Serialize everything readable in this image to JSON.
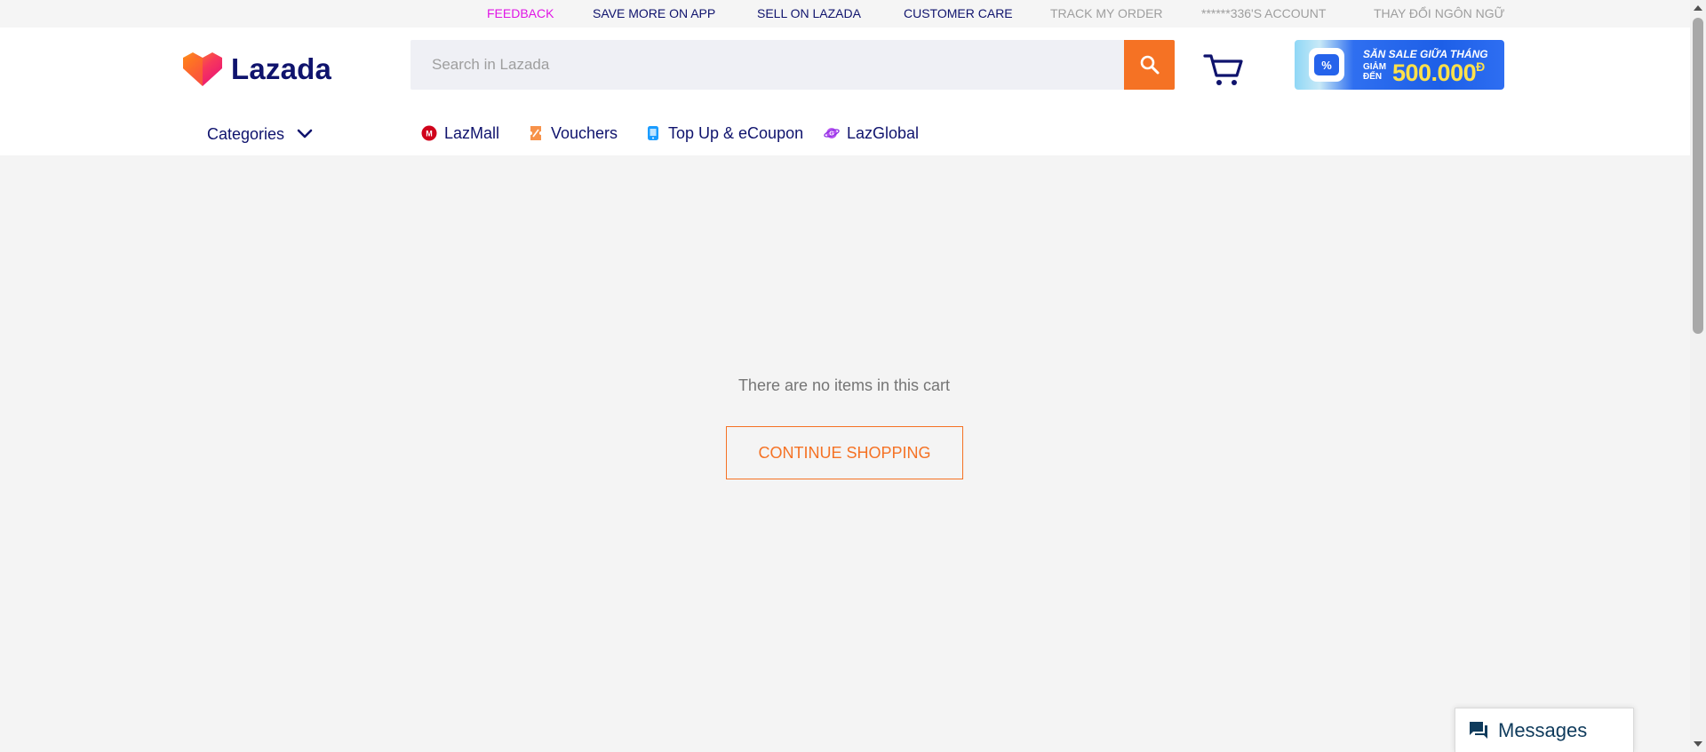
{
  "topbar": {
    "feedback": "FEEDBACK",
    "save_more": "SAVE MORE ON APP",
    "sell": "SELL ON LAZADA",
    "customer_care": "CUSTOMER CARE",
    "track_order": "TRACK MY ORDER",
    "account": "******336'S ACCOUNT",
    "language": "THAY ĐỔI NGÔN NGỮ"
  },
  "header": {
    "logo_text": "Lazada",
    "search_placeholder": "Search in Lazada",
    "search_icon": "search-icon",
    "cart_icon": "cart-icon",
    "banner": {
      "line1": "SĂN SALE GIỮA THÁNG",
      "sub": "GIẢM ĐẾN",
      "amount": "500.000",
      "currency": "Đ"
    }
  },
  "nav": {
    "categories": "Categories",
    "items": [
      {
        "label": "LazMall",
        "icon": "lazmall-icon"
      },
      {
        "label": "Vouchers",
        "icon": "voucher-icon"
      },
      {
        "label": "Top Up & eCoupon",
        "icon": "topup-icon"
      },
      {
        "label": "LazGlobal",
        "icon": "lazglobal-icon"
      }
    ]
  },
  "main": {
    "empty_message": "There are no items in this cart",
    "continue_label": "CONTINUE SHOPPING"
  },
  "messages": {
    "label": "Messages"
  },
  "colors": {
    "accent": "#f57224",
    "navy": "#0f136d",
    "feedback": "#e015e5",
    "muted": "#9e9e9e"
  }
}
